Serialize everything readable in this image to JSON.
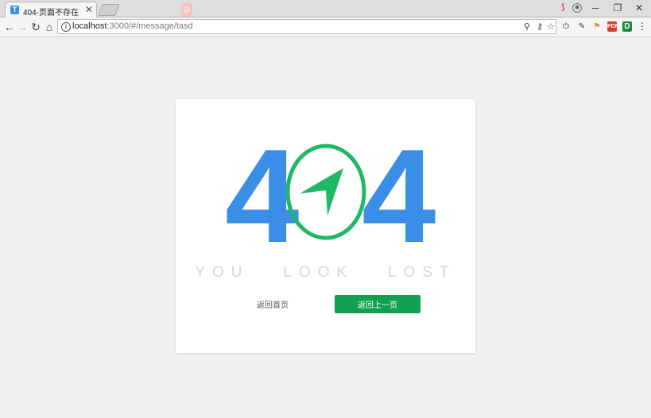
{
  "browser": {
    "tab": {
      "favicon_letter": "T",
      "title": "404-页面不存在",
      "close": "✕"
    },
    "window_controls": {
      "minimize": "─",
      "restore": "❐",
      "close": "✕"
    },
    "address": {
      "host": "localhost",
      "path": ":3000/#/message/tasd"
    },
    "extensions": [
      "power-icon",
      "pen-icon",
      "bookmark-icon",
      "pdf-icon",
      "d-icon",
      "menu-icon"
    ],
    "extension_labels": {
      "pdf": "PDF",
      "d": "D"
    }
  },
  "page": {
    "code_left": "4",
    "code_right": "4",
    "message": "YOU LOOK LOST",
    "home_button": "返回首页",
    "back_button": "返回上一页"
  },
  "colors": {
    "digit_blue": "#3a8ee6",
    "compass_green": "#1fb866",
    "button_green": "#0fa14f",
    "message_gray": "#d6d6d6"
  }
}
